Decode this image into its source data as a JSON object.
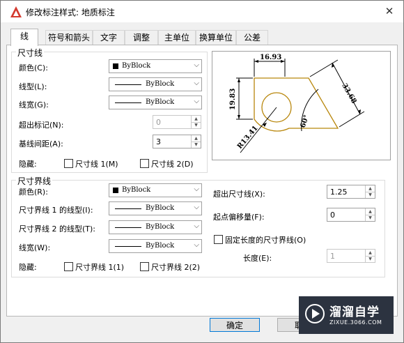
{
  "window": {
    "title": "修改标注样式: 地质标注",
    "close_glyph": "✕"
  },
  "tabs": [
    "线",
    "符号和箭头",
    "文字",
    "调整",
    "主单位",
    "换算单位",
    "公差"
  ],
  "dim_lines": {
    "group_label": "尺寸线",
    "color_label": "颜色(C):",
    "color_value": "ByBlock",
    "linetype_label": "线型(L):",
    "linetype_value": "ByBlock",
    "lineweight_label": "线宽(G):",
    "lineweight_value": "ByBlock",
    "extend_label": "超出标记(N):",
    "extend_value": "0",
    "baseline_label": "基线间距(A):",
    "baseline_value": "3",
    "suppress_label": "隐藏:",
    "suppress_1": "尺寸线 1(M)",
    "suppress_2": "尺寸线 2(D)"
  },
  "ext_lines": {
    "group_label": "尺寸界线",
    "color_label": "颜色(R):",
    "color_value": "ByBlock",
    "lt1_label": "尺寸界线 1 的线型(I):",
    "lt1_value": "ByBlock",
    "lt2_label": "尺寸界线 2 的线型(T):",
    "lt2_value": "ByBlock",
    "lineweight_label": "线宽(W):",
    "lineweight_value": "ByBlock",
    "suppress_label": "隐藏:",
    "suppress_1": "尺寸界线 1(1)",
    "suppress_2": "尺寸界线 2(2)",
    "beyond_label": "超出尺寸线(X):",
    "beyond_value": "1.25",
    "offset_label": "起点偏移量(F):",
    "offset_value": "0",
    "fixed_label": "固定长度的尺寸界线(O)",
    "length_label": "长度(E):",
    "length_value": "1"
  },
  "preview": {
    "dim_top": "16.93",
    "dim_left": "19.83",
    "dim_right": "33.68",
    "dim_angle": "60°",
    "dim_radius": "R13.41"
  },
  "buttons": {
    "ok": "确定",
    "cancel": "取"
  },
  "watermark": {
    "name": "溜溜自学",
    "url": "ZIXUE.3066.COM"
  },
  "colors": {
    "accent": "#0078d7",
    "autocad_red": "#d43a2f",
    "preview_geometry": "#b8860b"
  }
}
